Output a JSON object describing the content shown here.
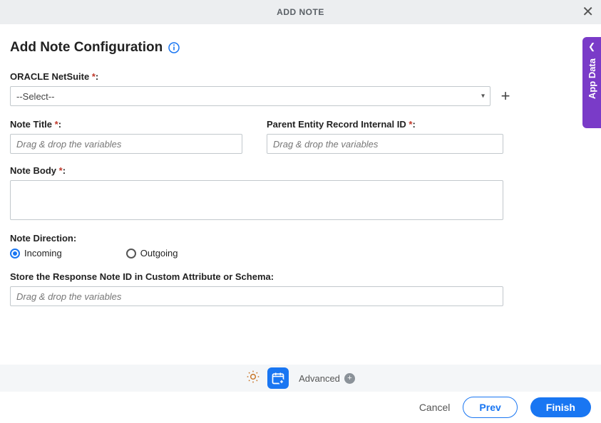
{
  "header": {
    "title": "ADD NOTE"
  },
  "page_title": "Add Note Configuration",
  "fields": {
    "oracle_netsuite": {
      "label": "ORACLE NetSuite",
      "required": "*",
      "colon": ":",
      "selected": "--Select--"
    },
    "note_title": {
      "label": "Note Title",
      "required": "*",
      "colon": ":",
      "placeholder": "Drag & drop the variables"
    },
    "parent_id": {
      "label": "Parent Entity Record Internal ID",
      "required": "*",
      "colon": ":",
      "placeholder": "Drag & drop the variables"
    },
    "note_body": {
      "label": "Note Body",
      "required": "*",
      "colon": ":"
    },
    "note_direction": {
      "label": "Note Direction:",
      "incoming": "Incoming",
      "outgoing": "Outgoing"
    },
    "store_response": {
      "label": "Store the Response Note ID in Custom Attribute or Schema:",
      "placeholder": "Drag & drop the variables"
    }
  },
  "side_tab": {
    "label": "App Data"
  },
  "toolbar": {
    "advanced": "Advanced"
  },
  "footer": {
    "cancel": "Cancel",
    "prev": "Prev",
    "finish": "Finish"
  }
}
